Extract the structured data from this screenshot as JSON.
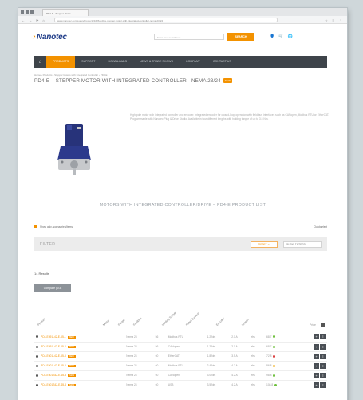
{
  "browser": {
    "tab_title": "PD4-E - Stepper Motor...",
    "url": "www.nanotec.com/eu/en/products/1626-pd4-e-stepper-motor-with-integrated-controller-nema-23-24",
    "nav": [
      "←",
      "→",
      "⟳",
      "⌂"
    ],
    "icons": [
      "☆",
      "≡",
      "⋮"
    ]
  },
  "header": {
    "logo": "Nanotec",
    "search_placeholder": "Enter your search text",
    "search_button": "SEARCH",
    "icons": [
      "user-icon",
      "cart-icon",
      "globe-icon"
    ]
  },
  "nav": {
    "items": [
      "PRODUCTS",
      "SUPPORT",
      "DOWNLOADS",
      "NEWS & TRADE SHOWS",
      "COMPANY",
      "CONTACT US"
    ],
    "active_index": 0
  },
  "breadcrumb": "Home › Products › Stepper Motors with Integrated Controller › PD4-E",
  "page_title": "PD4-E – STEPPER MOTOR WITH INTEGRATED CONTROLLER - NEMA 23/24",
  "title_badge": "NEW",
  "description": "High-pole motor with integrated controller and encoder. Integrated encoder for closed-loop operation with field bus interfaces such as CANopen, Modbus RTU or EtherCAT. Programmable with Nanotec Plug & Drive Studio. Available in four different lengths with holding torque of up to 3.5 Nm.",
  "section_title": "MOTORS WITH INTEGRATED CONTROLLER/DRIVE – PD4-E PRODUCT LIST",
  "options": {
    "left": "Show only accessories/items",
    "right": "Quickselect"
  },
  "filter": {
    "label": "FILTER",
    "reset": "RESET ✕",
    "select": "SHOW FILTERS"
  },
  "results": "14 Results",
  "compare_button": "Compare (0/3)",
  "columns": [
    "Product",
    "Motor",
    "Flange",
    "Fieldbus",
    "Holding Torque",
    "Rated Current",
    "Encoder",
    "Length"
  ],
  "column_right": "Price",
  "rows": [
    {
      "name": "PD4-E591L42-E-65-1",
      "c1": "Nema 23",
      "c2": "56",
      "c3": "Modbus RTU",
      "c4": "1.2 Nm",
      "c5": "2.1 A",
      "c6": "Yes",
      "c7": "68.7",
      "status": "#6cbf3a"
    },
    {
      "name": "PD4-E591L42-E-65-2",
      "c1": "Nema 23",
      "c2": "56",
      "c3": "CANopen",
      "c4": "1.2 Nm",
      "c5": "2.1 A",
      "c6": "Yes",
      "c7": "68.7",
      "status": "#6cbf3a"
    },
    {
      "name": "PD4-E601L42-E-65-3",
      "c1": "Nema 24",
      "c2": "60",
      "c3": "EtherCAT",
      "c4": "1.8 Nm",
      "c5": "3.5 A",
      "c6": "Yes",
      "c7": "72.8",
      "status": "#d93a3a"
    },
    {
      "name": "PD4-E601L42-E-65-4",
      "c1": "Nema 24",
      "c2": "60",
      "c3": "Modbus RTU",
      "c4": "2.4 Nm",
      "c5": "4.2 A",
      "c6": "Yes",
      "c7": "86.8",
      "status": "#f2b632"
    },
    {
      "name": "PD4-E601S42-E-65-5",
      "c1": "Nema 24",
      "c2": "60",
      "c3": "CANopen",
      "c4": "3.0 Nm",
      "c5": "4.2 A",
      "c6": "Yes",
      "c7": "98.8",
      "status": "#6cbf3a"
    },
    {
      "name": "PD4-E601S42-E-65-6",
      "c1": "Nema 24",
      "c2": "60",
      "c3": "USB",
      "c4": "3.5 Nm",
      "c5": "4.2 A",
      "c6": "Yes",
      "c7": "108.8",
      "status": "#6cbf3a"
    }
  ],
  "colors": {
    "accent": "#f39200",
    "nav_bg": "#3e444a",
    "brand_blue": "#1f3c88"
  }
}
